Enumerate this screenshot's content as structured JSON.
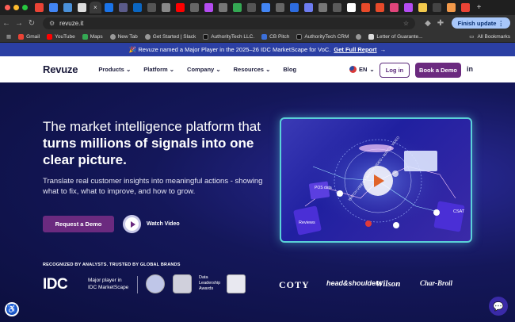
{
  "browser": {
    "active_tab_close": "×",
    "new_tab": "+",
    "url": "revuze.it",
    "finish_update": "Finish update",
    "bookmarks": [
      "Gmail",
      "YouTube",
      "Maps",
      "New Tab",
      "Get Started | Slack",
      "AuthorityTech LLC.",
      "CB Pitch",
      "AuthorityTech CRM",
      "Letter of Guarante..."
    ],
    "all_bookmarks": "All Bookmarks"
  },
  "banner": {
    "text": "🎉 Revuze named a Major Player in the 2025–26 IDC MarketScape for VoC.",
    "link": "Get Full Report",
    "arrow": "→"
  },
  "nav": {
    "logo": "Revuze",
    "links": [
      "Products",
      "Platform",
      "Company",
      "Resources",
      "Blog"
    ],
    "lang": "EN",
    "login": "Log in",
    "demo": "Book a Demo",
    "linkedin": "in"
  },
  "hero": {
    "title_plain": "The market intelligence platform that ",
    "title_bold": "turns millions of signals into one clear picture.",
    "subtitle": "Translate real customer insights into meaningful actions - showing what to fix, what to improve, and how to grow.",
    "cta": "Request a Demo",
    "watch": "Watch Video"
  },
  "visual": {
    "watch_ring": "WATCH VIDEO • WATCH VIDEO • WATCH VIDEO",
    "labels": [
      "POS data",
      "Reviews",
      "CSAT"
    ]
  },
  "analysts": {
    "heading": "RECOGNIZED BY ANALYSTS. TRUSTED BY GLOBAL BRANDS",
    "idc": "IDC",
    "idc_text": [
      "Major player in",
      "IDC MarketScape"
    ],
    "brands": [
      "COTY",
      "head&shoulders",
      "Wilson",
      "Char-Broil"
    ],
    "data_leadership": [
      "Data",
      "Leadership",
      "Awards"
    ]
  },
  "colors": {
    "accent": "#6b2a7f",
    "banner": "#2b3fa3",
    "hero_bg": "#14175a"
  }
}
